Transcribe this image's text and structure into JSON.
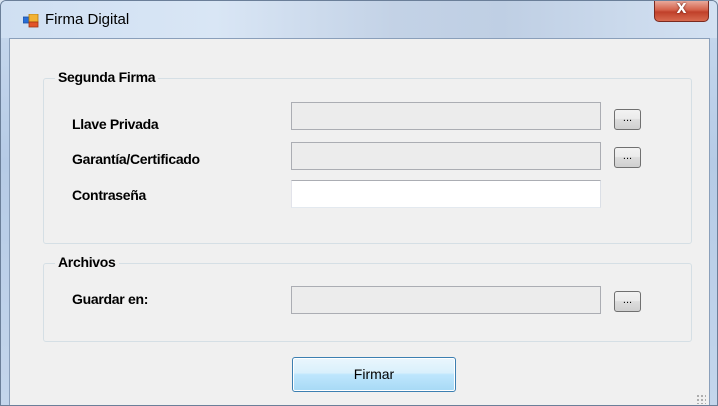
{
  "window": {
    "title": "Firma Digital",
    "close_label": "X"
  },
  "firma_group": {
    "legend": "Segunda Firma",
    "fields": [
      {
        "label": "Llave Privada",
        "value": "",
        "browse_label": "..."
      },
      {
        "label": "Garantía/Certificado",
        "value": "",
        "browse_label": "..."
      },
      {
        "label": "Contraseña",
        "value": ""
      }
    ]
  },
  "archivos_group": {
    "legend": "Archivos",
    "fields": [
      {
        "label": "Guardar en:",
        "value": "",
        "browse_label": "..."
      }
    ]
  },
  "actions": {
    "sign_label": "Firmar"
  },
  "colors": {
    "title_bar": "#cfdff2",
    "client_background": "#f0f0f0",
    "close_button": "#c0402a",
    "primary_button": "#bee6fd"
  }
}
